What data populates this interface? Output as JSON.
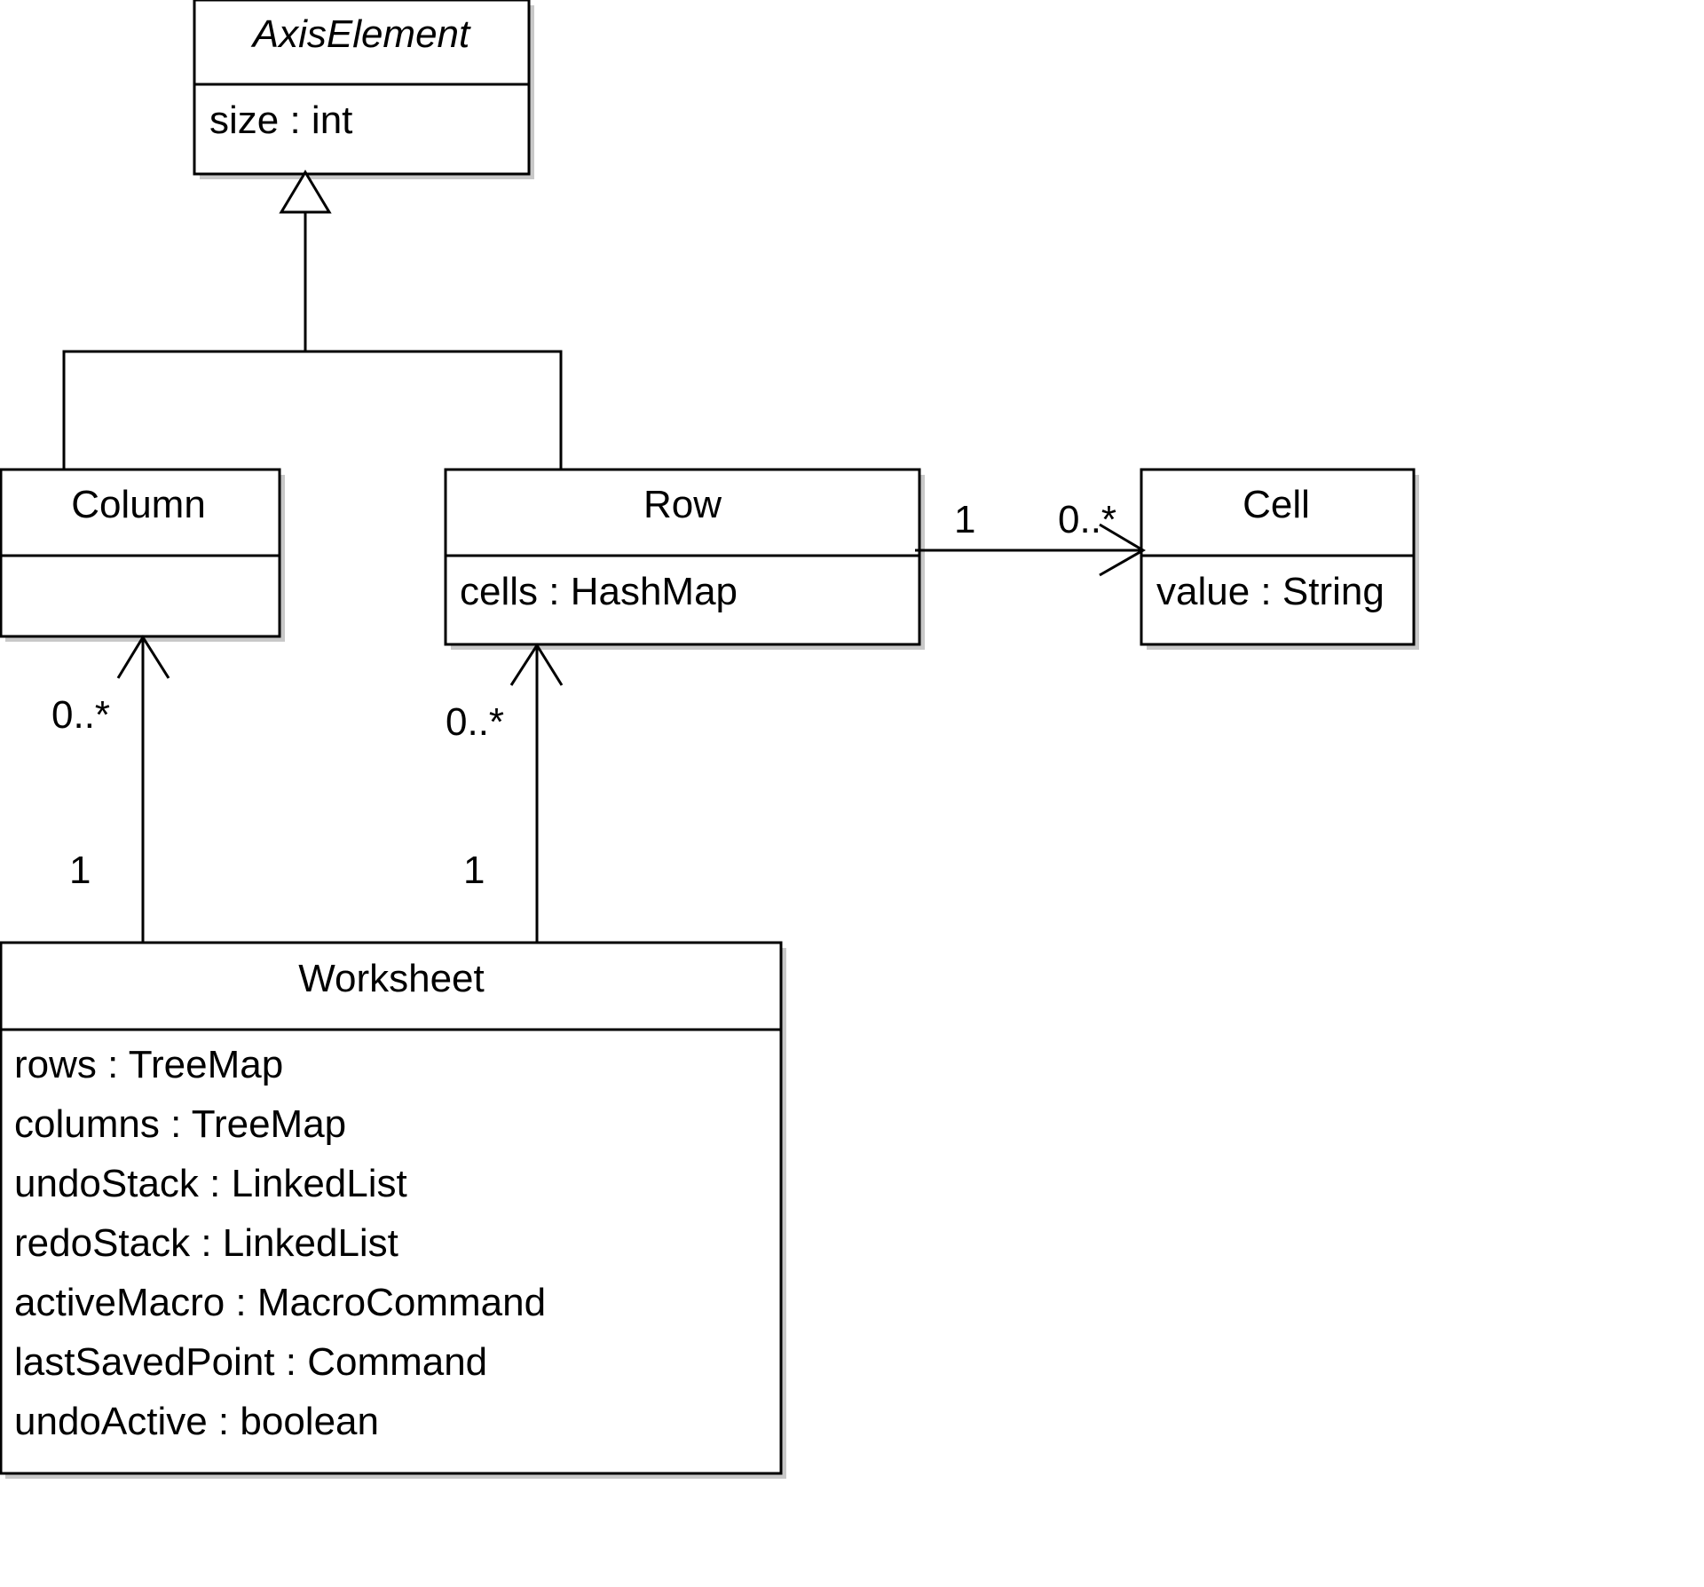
{
  "classes": {
    "axis_element": {
      "name": "AxisElement",
      "abstract": true,
      "attributes": [
        "size : int"
      ]
    },
    "column": {
      "name": "Column",
      "attributes": []
    },
    "row": {
      "name": "Row",
      "attributes": [
        "cells : HashMap"
      ]
    },
    "cell": {
      "name": "Cell",
      "attributes": [
        "value : String"
      ]
    },
    "worksheet": {
      "name": "Worksheet",
      "attributes": [
        "rows : TreeMap",
        "columns : TreeMap",
        "undoStack : LinkedList",
        "redoStack : LinkedList",
        "activeMacro : MacroCommand",
        "lastSavedPoint : Command",
        "undoActive : boolean"
      ]
    }
  },
  "relations": {
    "generalization": {
      "parent": "AxisElement",
      "children": [
        "Column",
        "Row"
      ]
    },
    "row_cell": {
      "source_multiplicity": "1",
      "target_multiplicity": "0..*"
    },
    "worksheet_column": {
      "source_multiplicity": "1",
      "target_multiplicity": "0..*"
    },
    "worksheet_row": {
      "source_multiplicity": "1",
      "target_multiplicity": "0..*"
    }
  }
}
